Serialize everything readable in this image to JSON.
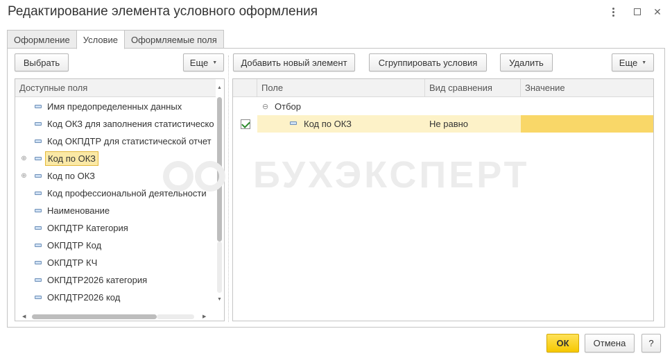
{
  "window": {
    "title": "Редактирование элемента условного оформления"
  },
  "tabs": [
    {
      "label": "Оформление"
    },
    {
      "label": "Условие"
    },
    {
      "label": "Оформляемые поля"
    }
  ],
  "left_toolbar": {
    "select_label": "Выбрать",
    "more_label": "Еще"
  },
  "available_fields": {
    "header": "Доступные поля",
    "items": [
      {
        "label": "Имя предопределенных данных"
      },
      {
        "label": "Код ОКЗ для заполнения статистическо"
      },
      {
        "label": "Код ОКПДТР для статистической отчет"
      },
      {
        "label": "Код по ОКЗ"
      },
      {
        "label": "Код по ОКЗ"
      },
      {
        "label": "Код профессиональной деятельности"
      },
      {
        "label": "Наименование"
      },
      {
        "label": "ОКПДТР Категория"
      },
      {
        "label": "ОКПДТР Код"
      },
      {
        "label": "ОКПДТР КЧ"
      },
      {
        "label": "ОКПДТР2026 категория"
      },
      {
        "label": "ОКПДТР2026 код"
      }
    ]
  },
  "right_toolbar": {
    "add_label": "Добавить новый элемент",
    "group_label": "Сгруппировать условия",
    "delete_label": "Удалить",
    "more_label": "Еще"
  },
  "conditions": {
    "columns": {
      "field": "Поле",
      "comparison": "Вид сравнения",
      "value": "Значение"
    },
    "root_label": "Отбор",
    "rows": [
      {
        "field": "Код по ОКЗ",
        "comparison": "Не равно",
        "value": ""
      }
    ]
  },
  "watermark": {
    "text": "БУХЭКСПЕРТ"
  },
  "footer": {
    "ok_label": "ОК",
    "cancel_label": "Отмена",
    "help_label": "?"
  },
  "colors": {
    "accent_yellow": "#f6c800",
    "selection": "#fbe9a6",
    "value_cell": "#f9d768",
    "checkmark": "#2c8a2c"
  }
}
